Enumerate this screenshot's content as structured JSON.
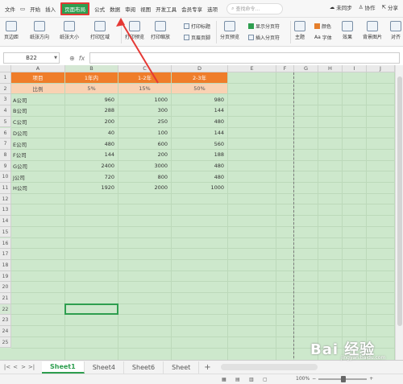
{
  "menubar": {
    "file": "文件",
    "items": [
      "开始",
      "插入",
      "页面布局",
      "公式",
      "数据",
      "审阅",
      "视图",
      "开发工具",
      "会员专享",
      "选项"
    ],
    "active_index": 2,
    "search_placeholder": "查找命令...",
    "unsynced": "未同步",
    "collab": "协作",
    "share": "分享"
  },
  "ribbon": {
    "margins": "页边距",
    "orientation": "纸张方向",
    "size": "纸张大小",
    "print_area": "打印区域",
    "print_preview": "打印预览",
    "print_scale": "打印缩放",
    "print_titles": "打印标题",
    "header_footer": "页眉页脚",
    "page_break_preview": "分页预览",
    "show_page_breaks": "显示分页符",
    "insert_page_break": "插入分页符",
    "theme": "主题",
    "colors": "颜色",
    "font": "字体",
    "effects": "效果",
    "background": "背景图片",
    "align": "对齐"
  },
  "formula_bar": {
    "name_box": "B22",
    "fx": "fx",
    "value": ""
  },
  "columns": [
    "A",
    "B",
    "C",
    "D",
    "E",
    "F",
    "G",
    "H",
    "I",
    "J"
  ],
  "rows": [
    "1",
    "2",
    "3",
    "4",
    "5",
    "6",
    "7",
    "8",
    "9",
    "10",
    "11",
    "12",
    "13",
    "14",
    "15",
    "16",
    "17",
    "18",
    "19",
    "20",
    "21",
    "22",
    "23",
    "24",
    "25"
  ],
  "table": {
    "header": [
      "项目",
      "1年内",
      "1-2年",
      "2-3年"
    ],
    "ratio": [
      "比例",
      "5%",
      "15%",
      "50%"
    ],
    "data": [
      [
        "A公司",
        "960",
        "1000",
        "980"
      ],
      [
        "B公司",
        "288",
        "300",
        "144"
      ],
      [
        "C公司",
        "200",
        "250",
        "480"
      ],
      [
        "D公司",
        "40",
        "100",
        "144"
      ],
      [
        "E公司",
        "480",
        "600",
        "560"
      ],
      [
        "F公司",
        "144",
        "200",
        "188"
      ],
      [
        "G公司",
        "2400",
        "3000",
        "480"
      ],
      [
        "J公司",
        "720",
        "800",
        "480"
      ],
      [
        "H公司",
        "1920",
        "2000",
        "1000"
      ]
    ]
  },
  "sheets": [
    "Sheet1",
    "Sheet4",
    "Sheet6",
    "Sheet"
  ],
  "active_sheet": "Sheet1",
  "add_sheet": "+",
  "status": {
    "zoom": "100%"
  },
  "colors": {
    "accent": "#2e9e4f",
    "header_orange": "#ef7d2a",
    "ratio_peach": "#f9d2b3",
    "sheet_bg": "#cde8cc"
  },
  "watermark": {
    "brand": "Bai  经验",
    "sub": "jingyan.baidu.com"
  }
}
